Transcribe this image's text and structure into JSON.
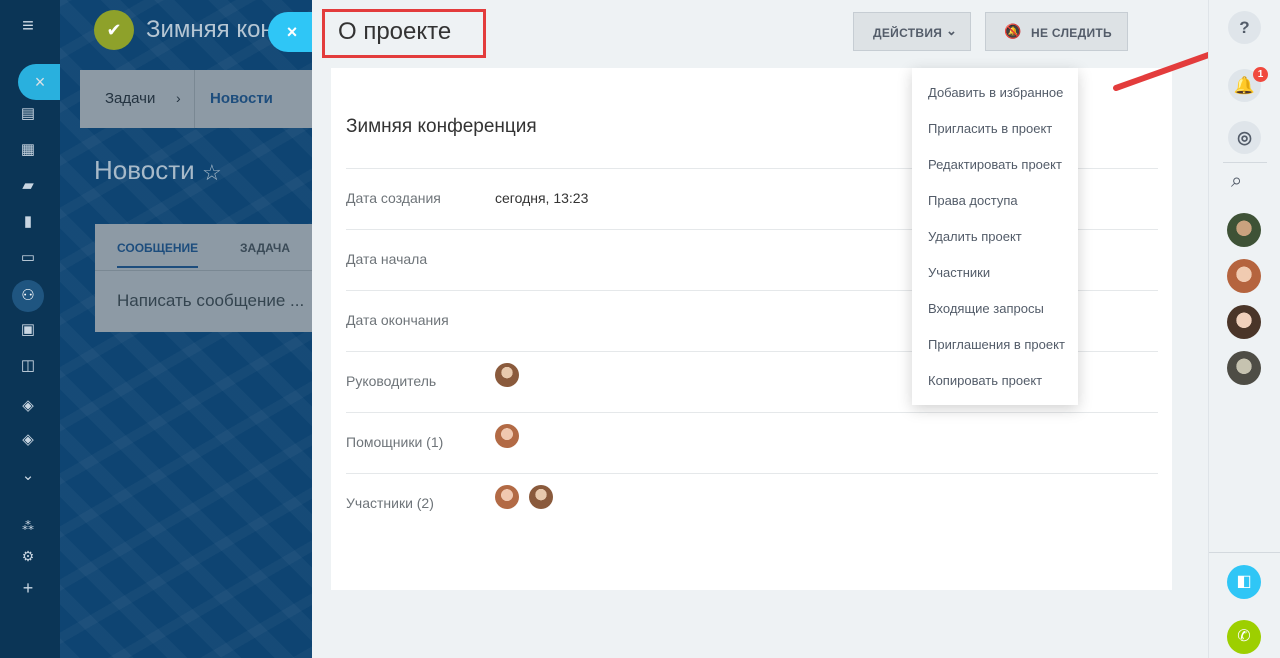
{
  "background_page": {
    "project_title": "Зимняя кон",
    "breadcrumb": {
      "tasks": "Задачи",
      "separator": "›",
      "news": "Новости"
    },
    "page_title": "Новости",
    "star_icon": "☆",
    "tabs": {
      "message": "СООБЩЕНИЕ",
      "task": "ЗАДАЧА"
    },
    "composer_placeholder": "Написать сообщение ..."
  },
  "panel": {
    "title": "О проекте",
    "actions_button": "ДЕЙСТВИЯ",
    "unfollow_button": "НЕ СЛЕДИТЬ",
    "highlight_color": "#e33c3c"
  },
  "project": {
    "name": "Зимняя конференция",
    "fields": [
      {
        "label": "Дата создания",
        "value": "сегодня, 13:23"
      },
      {
        "label": "Дата начала",
        "value": ""
      },
      {
        "label": "Дата окончания",
        "value": ""
      },
      {
        "label": "Руководитель",
        "value": ""
      },
      {
        "label": "Помощники (1)",
        "value": ""
      },
      {
        "label": "Участники (2)",
        "value": ""
      }
    ]
  },
  "actions_menu": [
    "Добавить в избранное",
    "Пригласить в проект",
    "Редактировать проект",
    "Права доступа",
    "Удалить проект",
    "Участники",
    "Входящие запросы",
    "Приглашения в проект",
    "Копировать проект"
  ],
  "right_sidebar": {
    "help_icon": "?",
    "notifications_badge": "1"
  },
  "colors": {
    "accent": "#2fc6f6",
    "link": "#1d4d7d",
    "phone": "#9dcf00",
    "badge": "#f0493e"
  }
}
